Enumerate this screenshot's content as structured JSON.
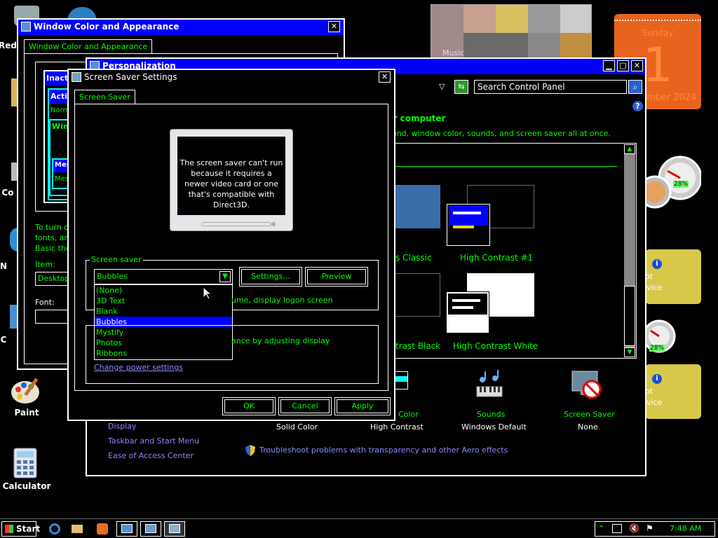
{
  "desktop": {
    "icons": [
      {
        "label": "Recycle Bin",
        "visible_text": "Red"
      },
      {
        "label": "Computer",
        "visible_text": "Co"
      },
      {
        "label": "Network",
        "visible_text": "N"
      },
      {
        "label": "Control Panel",
        "visible_text": "C"
      },
      {
        "label": "Paint",
        "visible_text": "Paint"
      },
      {
        "label": "Calculator",
        "visible_text": "Calculator"
      }
    ]
  },
  "gadgets": {
    "calendar_day": "Sunday",
    "calendar_date": "1",
    "calendar_month": "mber 2024",
    "slideshow_label": "Music",
    "cpu_percent_1": "28%",
    "cpu_percent_2": "28%",
    "weather_text_1": "ot",
    "weather_text_2": "vice",
    "weather_text_3": "ot",
    "weather_text_4": "vice"
  },
  "win_color": {
    "title": "Window Color and Appearance",
    "tab": "Window Color and Appearance",
    "preview_inactive": "Inacti",
    "preview_active": "Activ",
    "preview_normal": "Norm",
    "preview_window": "Wind",
    "preview_msg": "Mes",
    "preview_msg2": "Mes",
    "desc_line1": "To turn o",
    "desc_line2": "fonts, an",
    "desc_line3": "Basic the",
    "item_label": "Item:",
    "item_value": "Desktop",
    "font_label": "Font:"
  },
  "personalization": {
    "title": "Personalization",
    "search_placeholder": "Search Control Panel",
    "heading": "ur computer",
    "subheading": "ound, window color, sounds, and screen saver all at once.",
    "themes": [
      {
        "label": "s Classic"
      },
      {
        "label": "High Contrast #1"
      },
      {
        "label": "trast Black"
      },
      {
        "label": "High Contrast White"
      }
    ],
    "bottom_items": [
      {
        "title": "Color",
        "sub": "Solid Color"
      },
      {
        "title": "",
        "sub": "High Contrast"
      },
      {
        "title": "Sounds",
        "sub": "Windows Default"
      },
      {
        "title": "Screen Saver",
        "sub": "None"
      }
    ],
    "see_also": [
      "Display",
      "Taskbar and Start Menu",
      "Ease of Access Center"
    ],
    "troubleshoot": "Troubleshoot problems with transparency and other Aero effects"
  },
  "screensaver": {
    "title": "Screen Saver Settings",
    "tab": "Screen Saver",
    "preview_message": "The screen saver can't run because it requires a newer video card or one that's compatible with Direct3D.",
    "group_label": "Screen saver",
    "selected": "Bubbles",
    "options": [
      "(None)",
      "3D Text",
      "Blank",
      "Bubbles",
      "Mystify",
      "Photos",
      "Ribbons"
    ],
    "settings_btn": "Settings...",
    "preview_btn": "Preview",
    "resume_text": "ume, display logon screen",
    "power_text": "ance by adjusting display",
    "power_link": "Change power settings",
    "ok": "OK",
    "cancel": "Cancel",
    "apply": "Apply"
  },
  "taskbar": {
    "start": "Start",
    "time": "7:48 AM"
  },
  "colors": {
    "accent_green": "#00ff00",
    "title_blue": "#0000ff",
    "link": "#8a8aff"
  }
}
